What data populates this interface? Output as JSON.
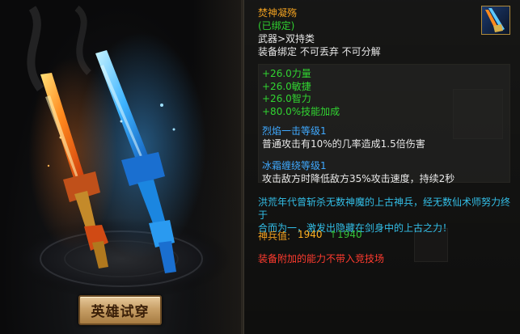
{
  "preview": {
    "try_button_label": "英雄试穿"
  },
  "tooltip": {
    "item_name": "焚神凝殇",
    "bind_state": "(已绑定)",
    "item_type": "武器>双持类",
    "flags": "装备绑定 不可丢弃 不可分解",
    "item_icon": "twin-swords-icon",
    "stats": [
      "+26.0力量",
      "+26.0敏捷",
      "+26.0智力",
      "+80.0%技能加成"
    ],
    "skills": [
      {
        "name": "烈焰一击等级1",
        "desc": "普通攻击有10%的几率造成1.5倍伤害"
      },
      {
        "name": "冰霜缠绕等级1",
        "desc": "攻击敌方时降低敌方35%攻击速度，持续2秒"
      }
    ],
    "lore_line1": "洪荒年代曾斩杀无数神魔的上古神兵，经无数仙术师努力终于",
    "lore_line2": "合而为一，激发出隐藏在剑身中的上古之力！",
    "power_label": "神兵值:",
    "power_value": "1940",
    "power_diff": "↑1940",
    "warning": "装备附加的能力不带入竞技场"
  },
  "colors": {
    "name": "#f0a020",
    "bound": "#30d030",
    "stat": "#31d431",
    "skill": "#3fa9ff",
    "lore": "#33bfe8",
    "warning": "#ff3b2f"
  }
}
